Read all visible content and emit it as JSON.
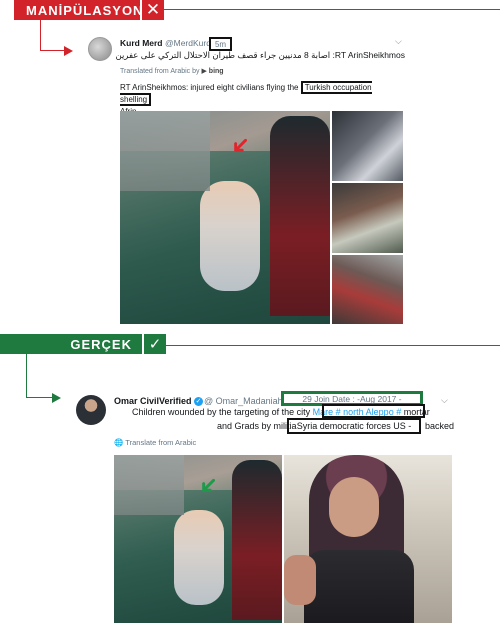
{
  "banners": {
    "manipulation": "MANİPÜLASYON",
    "manipulation_mark": "✕",
    "real": "GERÇEK",
    "real_mark": "✓"
  },
  "tweet_fake": {
    "name": "Kurd Merd",
    "handle": "@MerdKurd",
    "time": "5m",
    "arabic_text": "RT ArinSheikhmos: اصابة 8 مدنيين جراء قصف طيران الاحتلال التركي على عفرين",
    "translated_label": "Translated from Arabic by",
    "translator": "bing",
    "text_before_box": "RT ArinSheikhmos: injured eight civilians flying the",
    "text_boxed": "Turkish occupation shelling",
    "text_after_box": "Afrin"
  },
  "tweet_real": {
    "name": "Omar Civil",
    "verified_label": "Verified",
    "handle": "@ Omar_Madaniah",
    "join_date": "29 Join Date : -Aug 2017 -",
    "line1_before": "Children wounded by the targeting of the city",
    "line1_link": "Mare # north Aleppo #",
    "line1_after": "mortar",
    "line2_before": "and Grads by militia",
    "line2_boxed": "Syria democratic forces US -",
    "line2_after": "backed",
    "translate_label": "Translate from Arabic"
  },
  "colors": {
    "fake_red": "#d2232a",
    "real_green": "#1f7a3f",
    "twitter_blue": "#1da1f2"
  },
  "icons": {
    "fake": "close-icon",
    "real": "check-icon",
    "verified": "verified-badge-icon",
    "globe": "globe-icon"
  }
}
